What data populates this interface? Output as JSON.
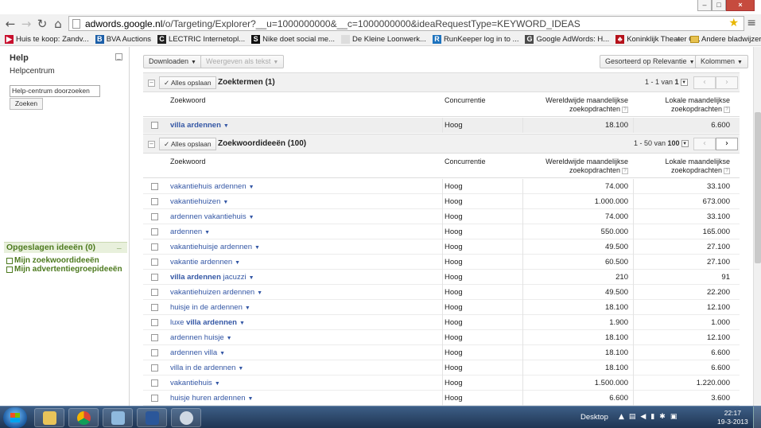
{
  "browser": {
    "url_host": "adwords.google.nl",
    "url_path": "/o/Targeting/Explorer?__u=1000000000&__c=1000000000&ideaRequestType=KEYWORD_IDEAS",
    "window_controls": [
      "–",
      "□",
      "×"
    ]
  },
  "bookmarks": [
    {
      "label": "Huis te koop: Zandv...",
      "icon": "funda-icon",
      "color": "#c8102e",
      "glyph": "▶"
    },
    {
      "label": "BVA Auctions",
      "icon": "bva-icon",
      "color": "#1c5fa8",
      "glyph": "B"
    },
    {
      "label": "LECTRIC Internetopl...",
      "icon": "lectric-icon",
      "color": "#222222",
      "glyph": "C"
    },
    {
      "label": "Nike doet social me...",
      "icon": "s-icon",
      "color": "#111111",
      "glyph": "S"
    },
    {
      "label": "De Kleine Loonwerk...",
      "icon": "page-icon",
      "color": "#dddddd",
      "glyph": ""
    },
    {
      "label": "RunKeeper log in to ...",
      "icon": "runkeeper-icon",
      "color": "#1e73be",
      "glyph": "R"
    },
    {
      "label": "Google AdWords: H...",
      "icon": "google-icon",
      "color": "#4a4a4a",
      "glyph": "G"
    },
    {
      "label": "Koninklijk Theater C...",
      "icon": "theater-icon",
      "color": "#b5121b",
      "glyph": "♣"
    }
  ],
  "bookmarks_more": "»",
  "bookmarks_folder": "Andere bladwijzers",
  "sidebar": {
    "help_title": "Help",
    "help_center": "Helpcentrum",
    "search_placeholder": "Help-centrum doorzoeken",
    "search_button": "Zoeken",
    "saved_title": "Opgeslagen ideeën (0)",
    "saved_items": [
      "Mijn zoekwoordideeën",
      "Mijn advertentiegroepideeën"
    ]
  },
  "toolbar": {
    "download": "Downloaden",
    "view_as_text": "Weergeven als tekst",
    "sort": "Gesorteerd op Relevantie",
    "columns": "Kolommen"
  },
  "search_terms": {
    "save_all": "Alles opslaan",
    "title": "Zoektermen (1)",
    "pager_prefix": "1 - 1 van ",
    "pager_total": "1",
    "columns": {
      "keyword": "Zoekwoord",
      "competition": "Concurrentie",
      "global_line1": "Wereldwijde maandelijkse",
      "global_line2": "zoekopdrachten",
      "local_line1": "Lokale maandelijkse",
      "local_line2": "zoekopdrachten"
    },
    "rows": [
      {
        "keyword": "villa ardennen",
        "bold_part": "villa ardennen",
        "rest": "",
        "competition": "Hoog",
        "global": "18.100",
        "local": "6.600"
      }
    ]
  },
  "keyword_ideas": {
    "save_all": "Alles opslaan",
    "title": "Zoekwoordideeën (100)",
    "pager_prefix": "1 - 50 van ",
    "pager_total": "100",
    "columns": {
      "keyword": "Zoekwoord",
      "competition": "Concurrentie",
      "global_line1": "Wereldwijde maandelijkse",
      "global_line2": "zoekopdrachten",
      "local_line1": "Lokale maandelijkse",
      "local_line2": "zoekopdrachten"
    },
    "rows": [
      {
        "bold_part": "",
        "rest": "vakantiehuis ardennen",
        "competition": "Hoog",
        "global": "74.000",
        "local": "33.100"
      },
      {
        "bold_part": "",
        "rest": "vakantiehuizen",
        "competition": "Hoog",
        "global": "1.000.000",
        "local": "673.000"
      },
      {
        "bold_part": "",
        "rest": "ardennen vakantiehuis",
        "competition": "Hoog",
        "global": "74.000",
        "local": "33.100"
      },
      {
        "bold_part": "",
        "rest": "ardennen",
        "competition": "Hoog",
        "global": "550.000",
        "local": "165.000"
      },
      {
        "bold_part": "",
        "rest": "vakantiehuisje ardennen",
        "competition": "Hoog",
        "global": "49.500",
        "local": "27.100"
      },
      {
        "bold_part": "",
        "rest": "vakantie ardennen",
        "competition": "Hoog",
        "global": "60.500",
        "local": "27.100"
      },
      {
        "bold_part": "villa ardennen",
        "rest": " jacuzzi",
        "competition": "Hoog",
        "global": "210",
        "local": "91"
      },
      {
        "bold_part": "",
        "rest": "vakantiehuizen ardennen",
        "competition": "Hoog",
        "global": "49.500",
        "local": "22.200"
      },
      {
        "bold_part": "",
        "rest": "huisje in de ardennen",
        "competition": "Hoog",
        "global": "18.100",
        "local": "12.100"
      },
      {
        "bold_part": "",
        "rest": "luxe ",
        "bold_after": "villa ardennen",
        "competition": "Hoog",
        "global": "1.900",
        "local": "1.000"
      },
      {
        "bold_part": "",
        "rest": "ardennen huisje",
        "competition": "Hoog",
        "global": "18.100",
        "local": "12.100"
      },
      {
        "bold_part": "",
        "rest": "ardennen villa",
        "competition": "Hoog",
        "global": "18.100",
        "local": "6.600"
      },
      {
        "bold_part": "",
        "rest": "villa in de ardennen",
        "competition": "Hoog",
        "global": "18.100",
        "local": "6.600"
      },
      {
        "bold_part": "",
        "rest": "vakantiehuis",
        "competition": "Hoog",
        "global": "1.500.000",
        "local": "1.220.000"
      },
      {
        "bold_part": "",
        "rest": "huisje huren ardennen",
        "competition": "Hoog",
        "global": "6.600",
        "local": "3.600"
      }
    ]
  },
  "taskbar": {
    "apps": [
      "explorer",
      "chrome",
      "notepad",
      "word",
      "outlook"
    ],
    "desktop_label": "Desktop",
    "time": "22:17",
    "date": "19-3-2013"
  }
}
